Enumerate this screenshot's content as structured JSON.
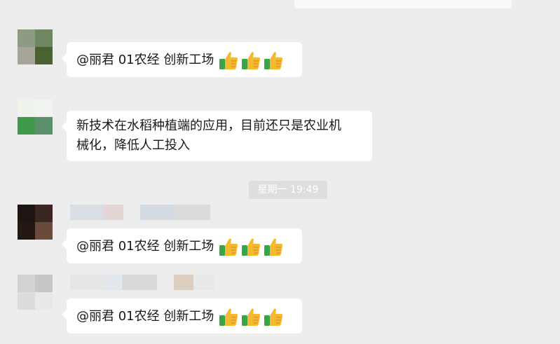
{
  "messages": [
    {
      "text": "@丽君 01农经 创新工场",
      "reactions": [
        "thumbs-up",
        "thumbs-up",
        "thumbs-up"
      ]
    },
    {
      "text_line1": "新技术在水稻种植端的应用，目前还只是农业机",
      "text_line2": "械化，降低人工投入"
    },
    {
      "text": "@丽君 01农经 创新工场",
      "reactions": [
        "thumbs-up",
        "thumbs-up",
        "thumbs-up"
      ]
    },
    {
      "text": "@丽君 01农经 创新工场",
      "reactions": [
        "thumbs-up",
        "thumbs-up",
        "thumbs-up"
      ]
    }
  ],
  "timestamp": "星期一 19:49",
  "colors": {
    "background": "#ededed",
    "bubble": "#ffffff",
    "text": "#191919",
    "timestamp_bg": "#dedede",
    "thumb_yellow": "#f5b82e",
    "cuff_green": "#3aa34a"
  }
}
